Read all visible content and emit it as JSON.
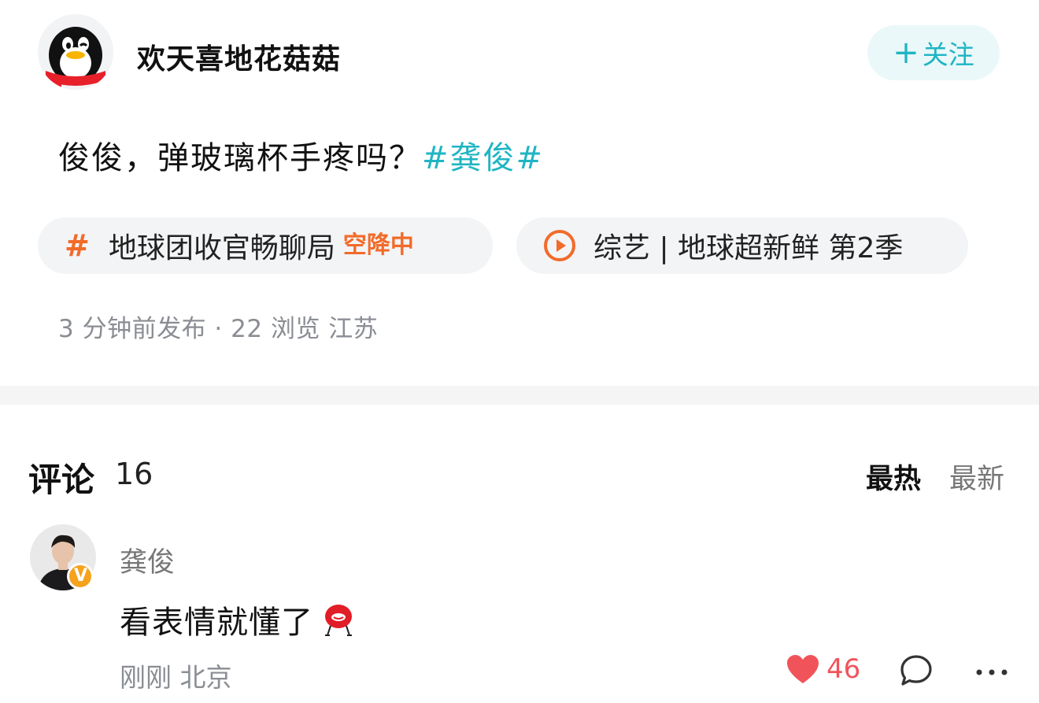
{
  "post": {
    "author": "欢天喜地花菇菇",
    "avatar_icon": "qq-penguin-avatar",
    "follow_label": "关注",
    "follow_plus": "+",
    "text": "俊俊，弹玻璃杯手疼吗？",
    "hashtag": "#龚俊#",
    "topic_chip": {
      "icon": "hash-icon",
      "hash": "#",
      "label": "地球团收官畅聊局",
      "badge": "空降中"
    },
    "show_chip": {
      "icon": "play-circle-icon",
      "label": "综艺 | 地球超新鲜 第2季"
    },
    "meta": "3 分钟前发布 · 22 浏览 江苏"
  },
  "comments": {
    "title": "评论",
    "count": "16",
    "sort_hot": "最热",
    "sort_new": "最新",
    "items": [
      {
        "author": "龚俊",
        "verified_badge": "V",
        "text": "看表情就懂了",
        "emoji": "red-blob-sticker",
        "time_location": "刚刚 北京",
        "likes": "46"
      }
    ]
  },
  "colors": {
    "accent": "#1fb5c3",
    "orange": "#f26b2a",
    "like_red": "#f0545a",
    "muted": "#8a8d93"
  }
}
